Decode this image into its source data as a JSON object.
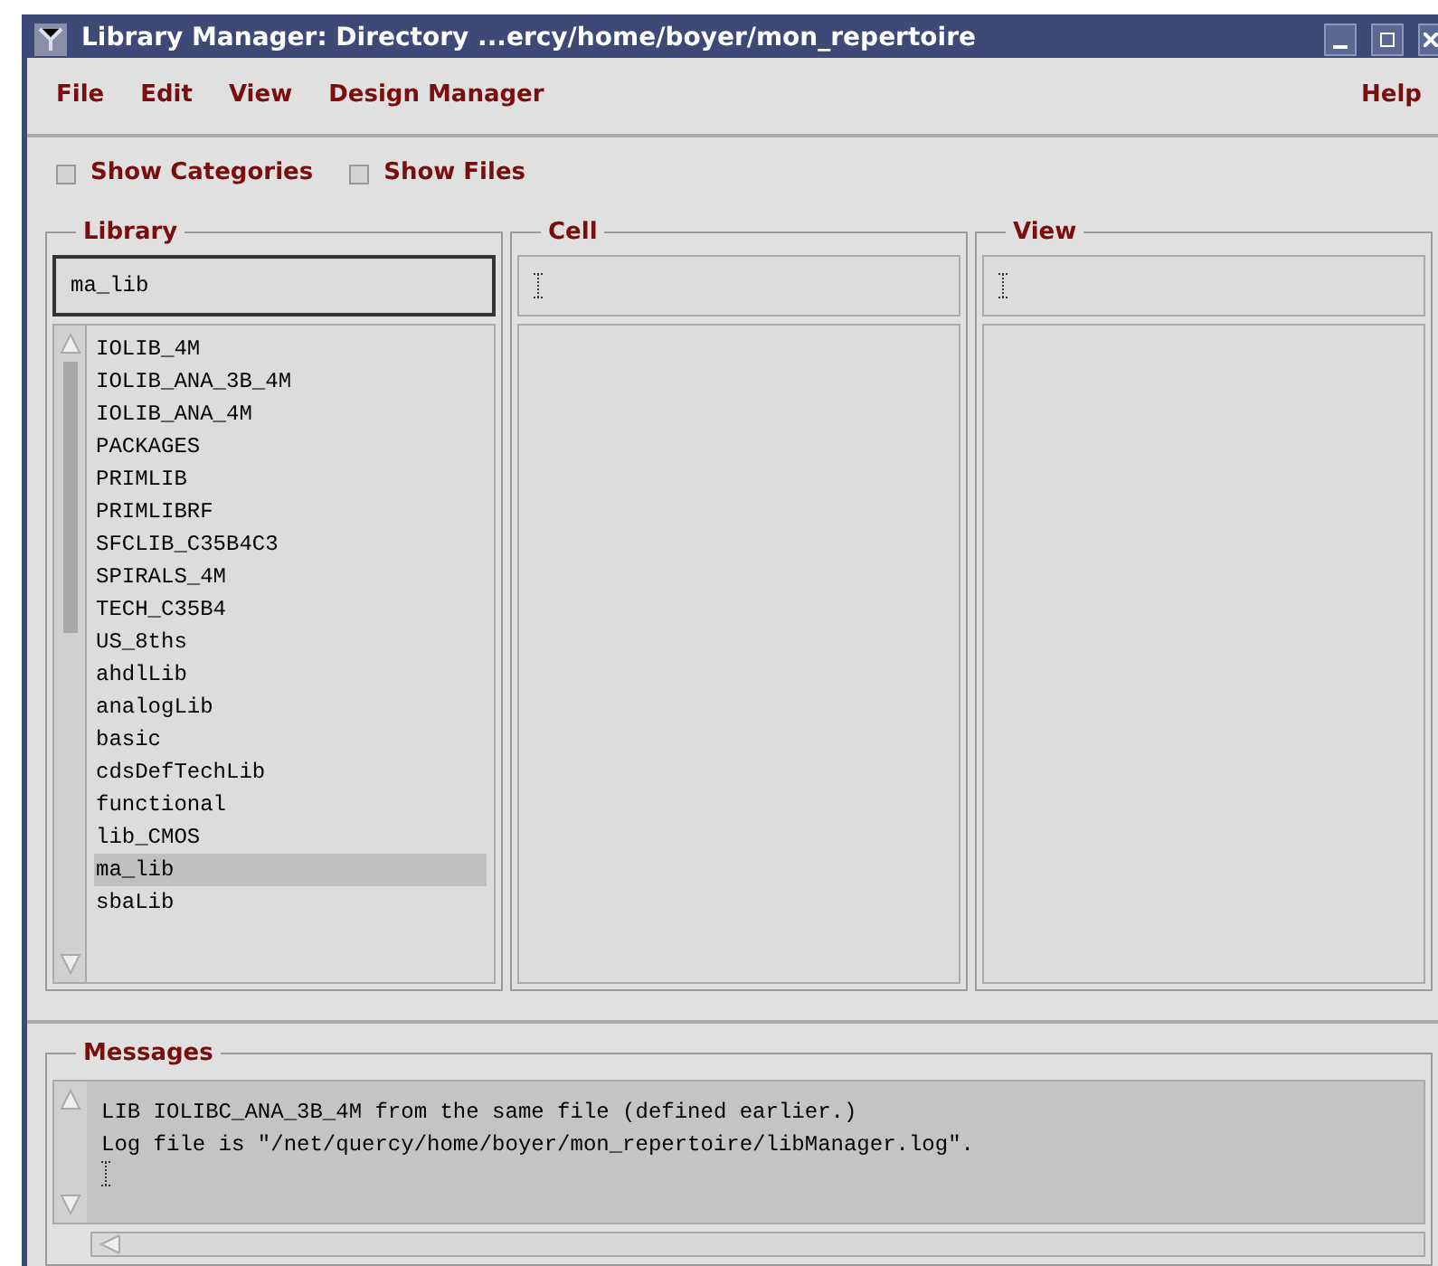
{
  "window": {
    "title": "Library Manager: Directory ...ercy/home/boyer/mon_repertoire"
  },
  "menu": {
    "left": [
      "File",
      "Edit",
      "View",
      "Design Manager"
    ],
    "right": [
      "Help"
    ]
  },
  "options": [
    {
      "label": "Show Categories",
      "checked": false
    },
    {
      "label": "Show Files",
      "checked": false
    }
  ],
  "library": {
    "title": "Library",
    "value": "ma_lib",
    "items": [
      {
        "label": "IOLIB_4M",
        "selected": false
      },
      {
        "label": "IOLIB_ANA_3B_4M",
        "selected": false
      },
      {
        "label": "IOLIB_ANA_4M",
        "selected": false
      },
      {
        "label": "PACKAGES",
        "selected": false
      },
      {
        "label": "PRIMLIB",
        "selected": false
      },
      {
        "label": "PRIMLIBRF",
        "selected": false
      },
      {
        "label": "SFCLIB_C35B4C3",
        "selected": false
      },
      {
        "label": "SPIRALS_4M",
        "selected": false
      },
      {
        "label": "TECH_C35B4",
        "selected": false
      },
      {
        "label": "US_8ths",
        "selected": false
      },
      {
        "label": "ahdlLib",
        "selected": false
      },
      {
        "label": "analogLib",
        "selected": false
      },
      {
        "label": "basic",
        "selected": false
      },
      {
        "label": "cdsDefTechLib",
        "selected": false
      },
      {
        "label": "functional",
        "selected": false
      },
      {
        "label": "lib_CMOS",
        "selected": false
      },
      {
        "label": "ma_lib",
        "selected": true
      },
      {
        "label": "sbaLib",
        "selected": false
      }
    ]
  },
  "cell": {
    "title": "Cell"
  },
  "view": {
    "title": "View"
  },
  "messages": {
    "title": "Messages",
    "lines": [
      "LIB IOLIBC_ANA_3B_4M from the same file (defined earlier.)",
      "Log file is \"/net/quercy/home/boyer/mon_repertoire/libManager.log\"."
    ]
  }
}
